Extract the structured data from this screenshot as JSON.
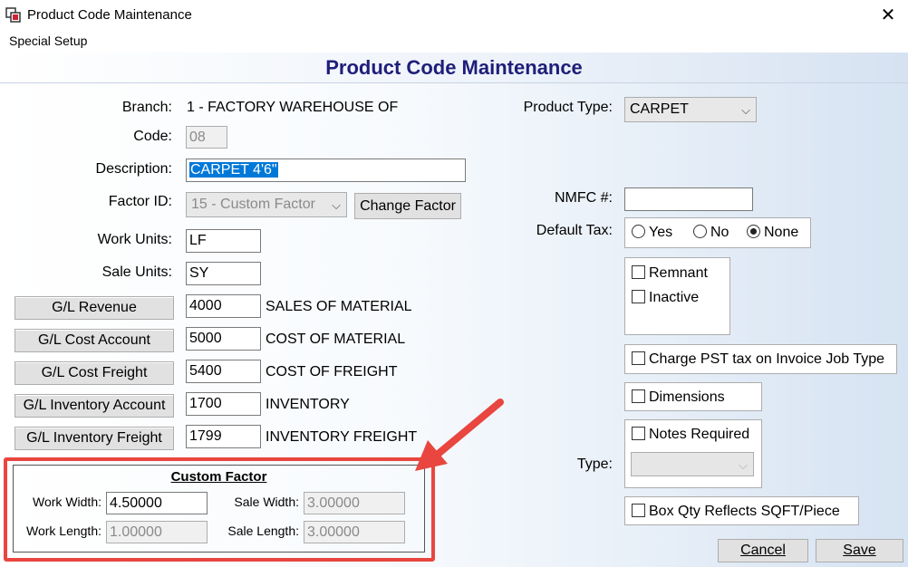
{
  "window": {
    "title": "Product Code Maintenance",
    "close_glyph": "✕"
  },
  "menu": {
    "items": [
      {
        "label": "Special Setup"
      }
    ]
  },
  "page": {
    "title": "Product Code Maintenance"
  },
  "form": {
    "branch": {
      "label": "Branch:",
      "value": "1  - FACTORY WAREHOUSE OF"
    },
    "code": {
      "label": "Code:",
      "value": "08"
    },
    "description": {
      "label": "Description:",
      "value": "CARPET 4'6\""
    },
    "factor_id": {
      "label": "Factor ID:",
      "value": "15 - Custom Factor",
      "change_button": "Change Factor"
    },
    "work_units": {
      "label": "Work Units:",
      "value": "LF"
    },
    "sale_units": {
      "label": "Sale Units:",
      "value": "SY"
    },
    "gl_accounts": [
      {
        "button": "G/L Revenue",
        "value": "4000",
        "desc": "SALES OF MATERIAL"
      },
      {
        "button": "G/L Cost Account",
        "value": "5000",
        "desc": "COST OF MATERIAL"
      },
      {
        "button": "G/L Cost Freight",
        "value": "5400",
        "desc": "COST OF FREIGHT"
      },
      {
        "button": "G/L Inventory Account",
        "value": "1700",
        "desc": "INVENTORY"
      },
      {
        "button": "G/L Inventory Freight",
        "value": "1799",
        "desc": "INVENTORY FREIGHT"
      }
    ],
    "product_type": {
      "label": "Product Type:",
      "value": "CARPET"
    },
    "nmfc": {
      "label": "NMFC #:",
      "value": ""
    },
    "default_tax": {
      "label": "Default Tax:",
      "options": [
        "Yes",
        "No",
        "None"
      ],
      "selected": "None"
    },
    "flags": {
      "remnant": "Remnant",
      "inactive": "Inactive"
    },
    "charge_pst": "Charge PST tax on Invoice Job Type",
    "dimensions": "Dimensions",
    "notes_required": "Notes Required",
    "type": {
      "label": "Type:",
      "value": ""
    },
    "box_qty": "Box Qty Reflects SQFT/Piece"
  },
  "custom_factor": {
    "title": "Custom Factor",
    "work_width": {
      "label": "Work Width:",
      "value": "4.50000"
    },
    "work_length": {
      "label": "Work Length:",
      "value": "1.00000"
    },
    "sale_width": {
      "label": "Sale Width:",
      "value": "3.00000"
    },
    "sale_length": {
      "label": "Sale Length:",
      "value": "3.00000"
    }
  },
  "actions": {
    "cancel": "Cancel",
    "save": "Save"
  },
  "colors": {
    "title_text": "#1e1e7a",
    "highlight": "#e8463f",
    "selection": "#0078d7"
  }
}
